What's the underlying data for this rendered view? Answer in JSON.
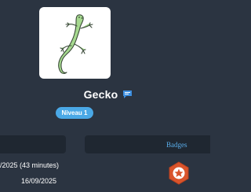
{
  "profile": {
    "username": "Gecko",
    "level_label": "Niveau 1",
    "avatar_icon": "gecko-icon",
    "chat_icon": "chat-bubble-icon"
  },
  "tabs": {
    "left_label": "",
    "badges_label": "Badges"
  },
  "stats": {
    "duration_text": "/2025 (43 minutes)",
    "date_text": "16/09/2025"
  },
  "badge": {
    "icon": "star-icon",
    "color": "#d9542b"
  },
  "colors": {
    "background": "#2b3441",
    "panel": "#1f2731",
    "accent": "#4aa8e6",
    "tab_text": "#5aaeeb",
    "gecko": "#9fd38a"
  }
}
